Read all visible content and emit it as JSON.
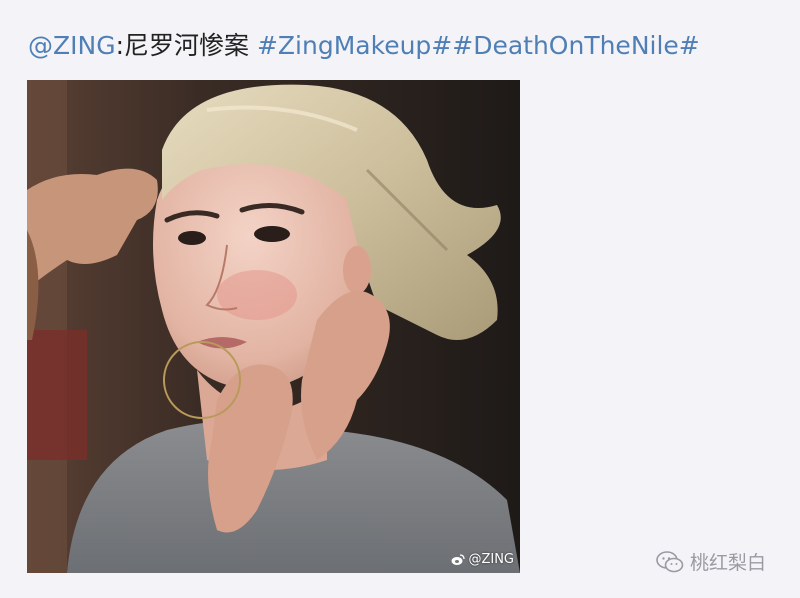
{
  "post": {
    "mention": "@ZING",
    "separator": ":",
    "title_text": "尼罗河惨案",
    "hashtag_1": "#ZingMakeup#",
    "hashtag_2": "#DeathOnTheNile#"
  },
  "photo": {
    "watermark": "@ZING",
    "watermark_icon": "weibo-icon"
  },
  "footer": {
    "wechat_icon": "wechat-icon",
    "account_name": "桃红梨白"
  },
  "colors": {
    "link": "#4f7fb5",
    "text": "#222222",
    "background": "#f4f4f8"
  }
}
